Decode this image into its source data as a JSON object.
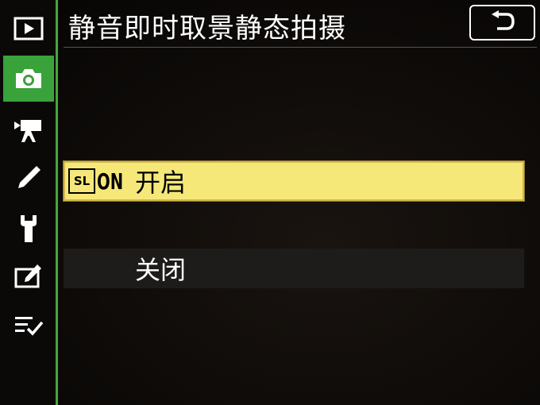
{
  "header": {
    "title": "静音即时取景静态拍摄",
    "back_icon": "return-arrow-icon"
  },
  "sidebar": {
    "items": [
      {
        "icon": "playback-icon",
        "active": false
      },
      {
        "icon": "camera-icon",
        "active": true
      },
      {
        "icon": "movie-camera-icon",
        "active": false
      },
      {
        "icon": "pencil-icon",
        "active": false
      },
      {
        "icon": "wrench-icon",
        "active": false
      },
      {
        "icon": "retouch-icon",
        "active": false
      },
      {
        "icon": "my-menu-icon",
        "active": false
      }
    ],
    "accent_color": "#3aa23a"
  },
  "options": [
    {
      "badge_box": "SL",
      "badge_on": "ON",
      "label": "开启",
      "selected": true
    },
    {
      "label": "关闭",
      "selected": false
    }
  ],
  "colors": {
    "selected_bg": "#f5e879",
    "normal_bg": "#1e1c1a"
  }
}
